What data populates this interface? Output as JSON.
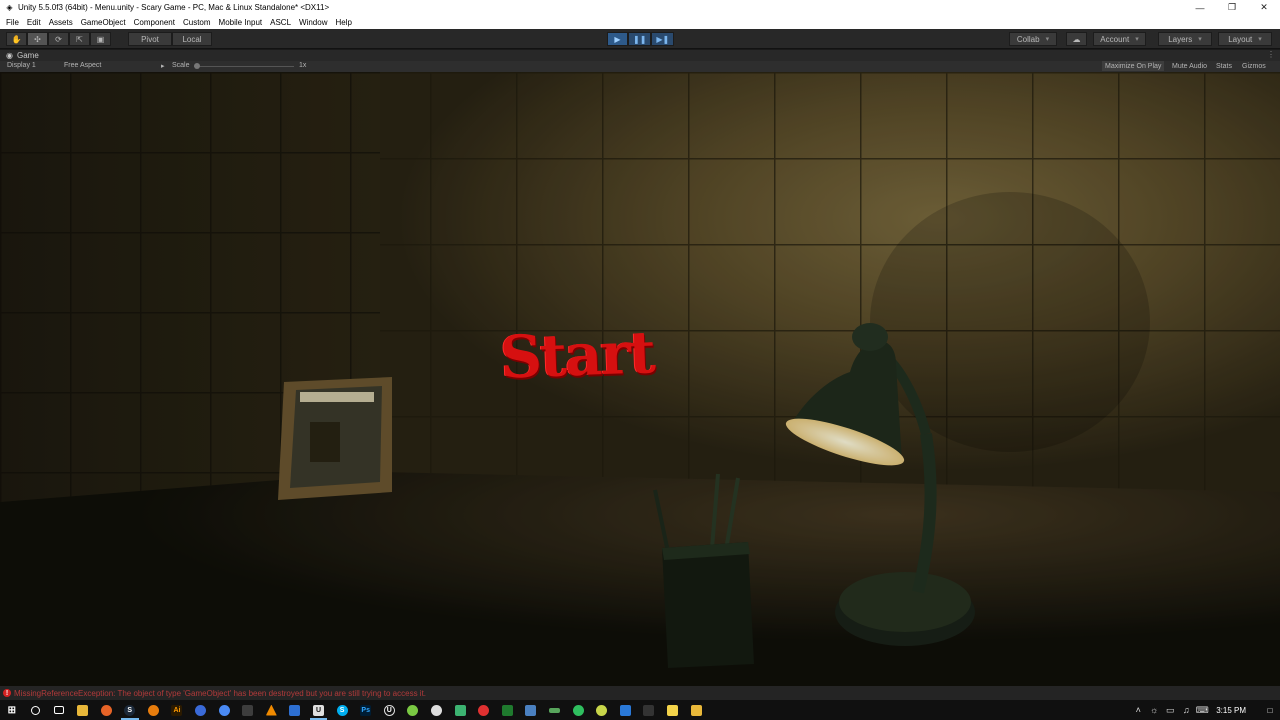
{
  "window": {
    "title": "Unity 5.5.0f3 (64bit) - Menu.unity - Scary Game - PC, Mac & Linux Standalone* <DX11>",
    "controls": [
      "minimize",
      "restore",
      "close"
    ]
  },
  "menubar": [
    "File",
    "Edit",
    "Assets",
    "GameObject",
    "Component",
    "Custom",
    "Mobile Input",
    "ASCL",
    "Window",
    "Help"
  ],
  "toolbar": {
    "pivot_label": "Pivot",
    "local_label": "Local",
    "collab_label": "Collab",
    "account_label": "Account",
    "layers_label": "Layers",
    "layout_label": "Layout"
  },
  "game_panel": {
    "tab_label": "Game",
    "display_label": "Display 1",
    "aspect_label": "Free Aspect",
    "scale_label": "Scale",
    "scale_value": "1x",
    "maximize_label": "Maximize On Play",
    "mute_label": "Mute Audio",
    "stats_label": "Stats",
    "gizmos_label": "Gizmos"
  },
  "scene": {
    "start_label": "Start"
  },
  "console": {
    "message": "MissingReferenceException: The object of type 'GameObject' has been destroyed but you are still trying to access it."
  },
  "taskbar": {
    "icons": [
      "windows-start-icon",
      "cortana-icon",
      "task-view-icon",
      "file-explorer-icon",
      "firefox-icon",
      "steam-icon",
      "blender-icon",
      "illustrator-icon",
      "browser-icon",
      "chrome-icon",
      "calculator-icon",
      "vlc-icon",
      "app-icon",
      "unity-icon",
      "skype-icon",
      "photoshop-icon",
      "unreal-icon",
      "app-icon-2",
      "app-icon-3",
      "app-icon-4",
      "app-icon-5",
      "app-icon-6",
      "app-icon-7",
      "app-icon-8",
      "app-icon-9",
      "app-icon-10",
      "app-icon-11",
      "app-icon-12",
      "app-icon-13",
      "app-icon-14"
    ],
    "clock": "3:15 PM"
  },
  "colors": {
    "start_text": "#d61010",
    "console_error": "#b23a3a",
    "play_button": "#2e5a8a"
  }
}
